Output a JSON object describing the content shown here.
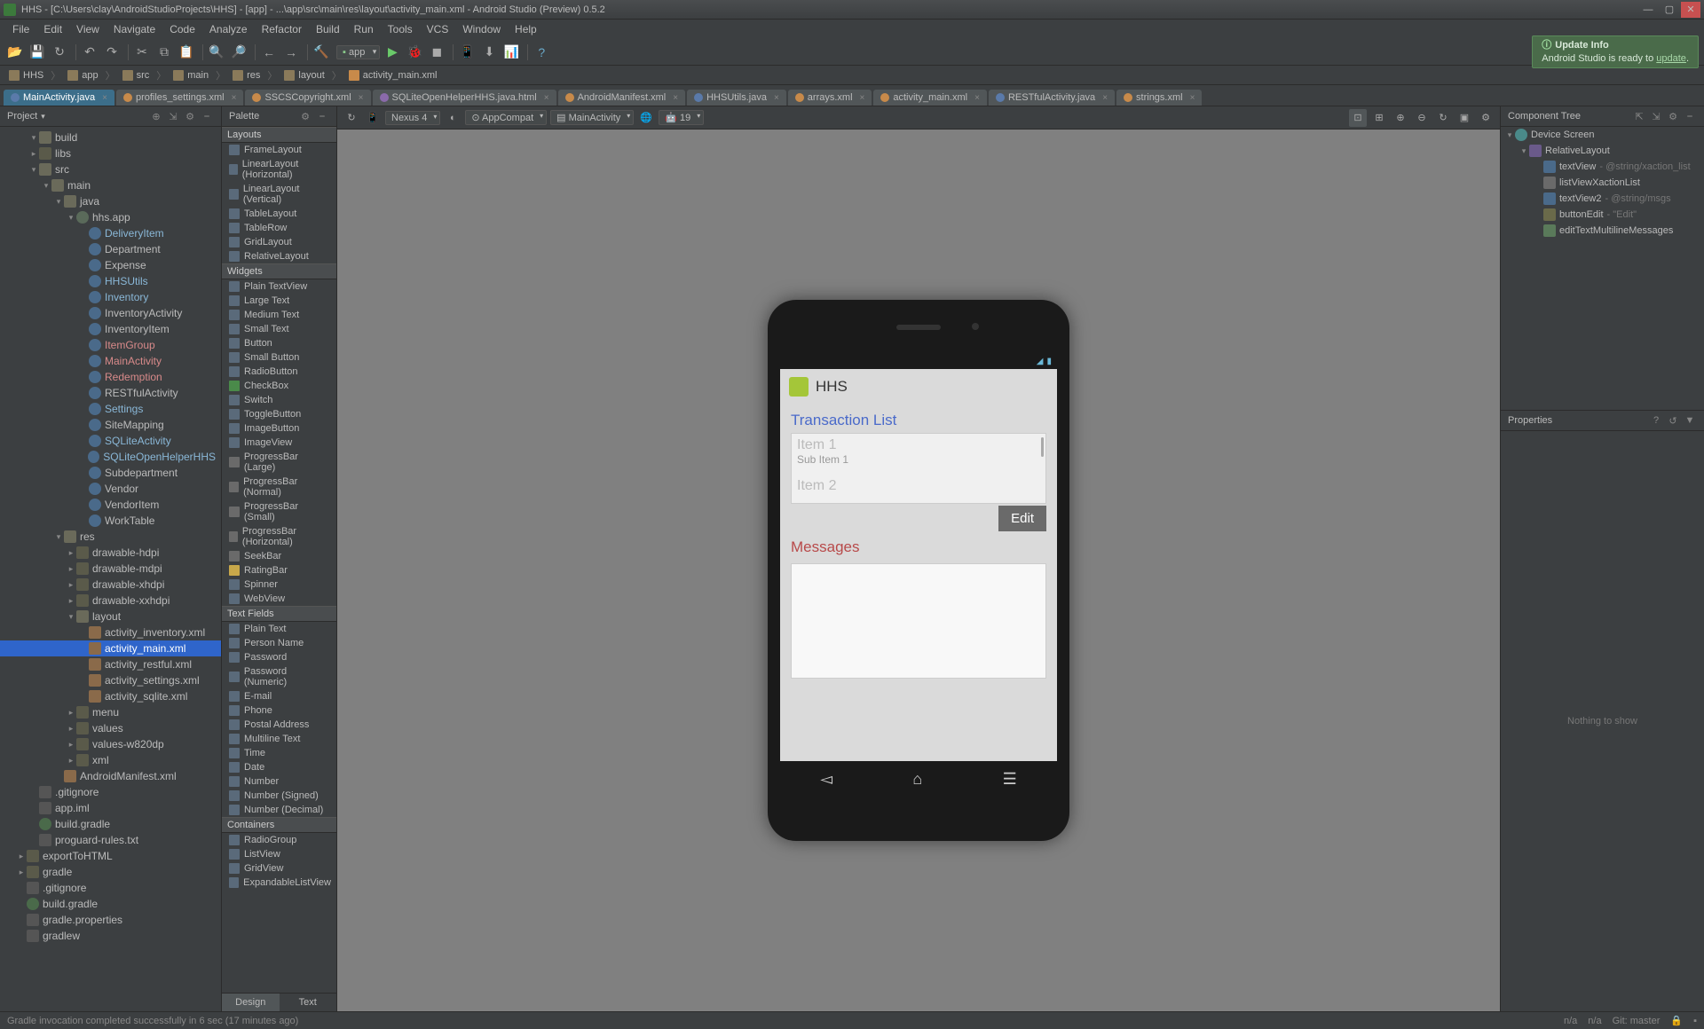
{
  "title": "HHS - [C:\\Users\\clay\\AndroidStudioProjects\\HHS] - [app] - ...\\app\\src\\main\\res\\layout\\activity_main.xml - Android Studio (Preview) 0.5.2",
  "menu": [
    "File",
    "Edit",
    "View",
    "Navigate",
    "Code",
    "Analyze",
    "Refactor",
    "Build",
    "Run",
    "Tools",
    "VCS",
    "Window",
    "Help"
  ],
  "toolbar": {
    "run_config": "app"
  },
  "notice": {
    "title": "Update Info",
    "msg_prefix": "Android Studio is ready to ",
    "link": "update",
    "msg_suffix": "."
  },
  "crumbs": [
    "HHS",
    "app",
    "src",
    "main",
    "res",
    "layout",
    "activity_main.xml"
  ],
  "tabs": [
    {
      "label": "MainActivity.java",
      "kind": "java",
      "active": true
    },
    {
      "label": "profiles_settings.xml",
      "kind": "xml"
    },
    {
      "label": "SSCSCopyright.xml",
      "kind": "xml"
    },
    {
      "label": "SQLiteOpenHelperHHS.java.html",
      "kind": "html"
    },
    {
      "label": "AndroidManifest.xml",
      "kind": "xml"
    },
    {
      "label": "HHSUtils.java",
      "kind": "java"
    },
    {
      "label": "arrays.xml",
      "kind": "xml"
    },
    {
      "label": "activity_main.xml",
      "kind": "xml"
    },
    {
      "label": "RESTfulActivity.java",
      "kind": "java"
    },
    {
      "label": "strings.xml",
      "kind": "xml"
    }
  ],
  "project": {
    "title": "Project"
  },
  "tree": [
    {
      "d": 2,
      "a": "▾",
      "i": "folder open",
      "t": "build"
    },
    {
      "d": 2,
      "a": "▸",
      "i": "folder",
      "t": "libs"
    },
    {
      "d": 2,
      "a": "▾",
      "i": "folder open",
      "t": "src"
    },
    {
      "d": 3,
      "a": "▾",
      "i": "folder open",
      "t": "main"
    },
    {
      "d": 4,
      "a": "▾",
      "i": "folder open",
      "t": "java"
    },
    {
      "d": 5,
      "a": "▾",
      "i": "pkg",
      "t": "hhs.app"
    },
    {
      "d": 6,
      "a": "",
      "i": "cls",
      "t": "DeliveryItem",
      "c": "blue"
    },
    {
      "d": 6,
      "a": "",
      "i": "cls",
      "t": "Department"
    },
    {
      "d": 6,
      "a": "",
      "i": "cls",
      "t": "Expense"
    },
    {
      "d": 6,
      "a": "",
      "i": "cls",
      "t": "HHSUtils",
      "c": "blue"
    },
    {
      "d": 6,
      "a": "",
      "i": "cls",
      "t": "Inventory",
      "c": "blue"
    },
    {
      "d": 6,
      "a": "",
      "i": "cls",
      "t": "InventoryActivity"
    },
    {
      "d": 6,
      "a": "",
      "i": "cls",
      "t": "InventoryItem"
    },
    {
      "d": 6,
      "a": "",
      "i": "cls",
      "t": "ItemGroup",
      "c": "red"
    },
    {
      "d": 6,
      "a": "",
      "i": "cls",
      "t": "MainActivity",
      "c": "red"
    },
    {
      "d": 6,
      "a": "",
      "i": "cls",
      "t": "Redemption",
      "c": "red"
    },
    {
      "d": 6,
      "a": "",
      "i": "cls",
      "t": "RESTfulActivity"
    },
    {
      "d": 6,
      "a": "",
      "i": "cls",
      "t": "Settings",
      "c": "blue"
    },
    {
      "d": 6,
      "a": "",
      "i": "cls",
      "t": "SiteMapping"
    },
    {
      "d": 6,
      "a": "",
      "i": "cls",
      "t": "SQLiteActivity",
      "c": "blue"
    },
    {
      "d": 6,
      "a": "",
      "i": "cls",
      "t": "SQLiteOpenHelperHHS",
      "c": "blue"
    },
    {
      "d": 6,
      "a": "",
      "i": "cls",
      "t": "Subdepartment"
    },
    {
      "d": 6,
      "a": "",
      "i": "cls",
      "t": "Vendor"
    },
    {
      "d": 6,
      "a": "",
      "i": "cls",
      "t": "VendorItem"
    },
    {
      "d": 6,
      "a": "",
      "i": "cls",
      "t": "WorkTable"
    },
    {
      "d": 4,
      "a": "▾",
      "i": "folder open",
      "t": "res"
    },
    {
      "d": 5,
      "a": "▸",
      "i": "folder",
      "t": "drawable-hdpi"
    },
    {
      "d": 5,
      "a": "▸",
      "i": "folder",
      "t": "drawable-mdpi"
    },
    {
      "d": 5,
      "a": "▸",
      "i": "folder",
      "t": "drawable-xhdpi"
    },
    {
      "d": 5,
      "a": "▸",
      "i": "folder",
      "t": "drawable-xxhdpi"
    },
    {
      "d": 5,
      "a": "▾",
      "i": "folder open",
      "t": "layout"
    },
    {
      "d": 6,
      "a": "",
      "i": "xml",
      "t": "activity_inventory.xml"
    },
    {
      "d": 6,
      "a": "",
      "i": "xml",
      "t": "activity_main.xml",
      "sel": true
    },
    {
      "d": 6,
      "a": "",
      "i": "xml",
      "t": "activity_restful.xml"
    },
    {
      "d": 6,
      "a": "",
      "i": "xml",
      "t": "activity_settings.xml"
    },
    {
      "d": 6,
      "a": "",
      "i": "xml",
      "t": "activity_sqlite.xml"
    },
    {
      "d": 5,
      "a": "▸",
      "i": "folder",
      "t": "menu"
    },
    {
      "d": 5,
      "a": "▸",
      "i": "folder",
      "t": "values"
    },
    {
      "d": 5,
      "a": "▸",
      "i": "folder",
      "t": "values-w820dp"
    },
    {
      "d": 5,
      "a": "▸",
      "i": "folder",
      "t": "xml"
    },
    {
      "d": 4,
      "a": "",
      "i": "xml",
      "t": "AndroidManifest.xml"
    },
    {
      "d": 2,
      "a": "",
      "i": "file",
      "t": ".gitignore"
    },
    {
      "d": 2,
      "a": "",
      "i": "file",
      "t": "app.iml"
    },
    {
      "d": 2,
      "a": "",
      "i": "gradle",
      "t": "build.gradle"
    },
    {
      "d": 2,
      "a": "",
      "i": "file",
      "t": "proguard-rules.txt"
    },
    {
      "d": 1,
      "a": "▸",
      "i": "folder",
      "t": "exportToHTML"
    },
    {
      "d": 1,
      "a": "▸",
      "i": "folder",
      "t": "gradle"
    },
    {
      "d": 1,
      "a": "",
      "i": "file",
      "t": ".gitignore"
    },
    {
      "d": 1,
      "a": "",
      "i": "gradle",
      "t": "build.gradle"
    },
    {
      "d": 1,
      "a": "",
      "i": "file",
      "t": "gradle.properties"
    },
    {
      "d": 1,
      "a": "",
      "i": "file",
      "t": "gradlew"
    }
  ],
  "palette": {
    "title": "Palette",
    "groups": [
      {
        "name": "Layouts",
        "items": [
          "FrameLayout",
          "LinearLayout (Horizontal)",
          "LinearLayout (Vertical)",
          "TableLayout",
          "TableRow",
          "GridLayout",
          "RelativeLayout"
        ]
      },
      {
        "name": "Widgets",
        "items": [
          "Plain TextView",
          "Large Text",
          "Medium Text",
          "Small Text",
          "Button",
          "Small Button",
          "RadioButton",
          "CheckBox",
          "Switch",
          "ToggleButton",
          "ImageButton",
          "ImageView",
          "ProgressBar (Large)",
          "ProgressBar (Normal)",
          "ProgressBar (Small)",
          "ProgressBar (Horizontal)",
          "SeekBar",
          "RatingBar",
          "Spinner",
          "WebView"
        ]
      },
      {
        "name": "Text Fields",
        "items": [
          "Plain Text",
          "Person Name",
          "Password",
          "Password (Numeric)",
          "E-mail",
          "Phone",
          "Postal Address",
          "Multiline Text",
          "Time",
          "Date",
          "Number",
          "Number (Signed)",
          "Number (Decimal)"
        ]
      },
      {
        "name": "Containers",
        "items": [
          "RadioGroup",
          "ListView",
          "GridView",
          "ExpandableListView"
        ]
      }
    ],
    "tabs": {
      "design": "Design",
      "text": "Text"
    }
  },
  "design_toolbar": {
    "device": "Nexus 4",
    "theme": "AppCompat",
    "activity": "MainActivity",
    "api": "19"
  },
  "preview": {
    "app_title": "HHS",
    "section1": "Transaction List",
    "list_item1": "Item 1",
    "list_sub1": "Sub Item 1",
    "list_item2": "Item 2",
    "edit_btn": "Edit",
    "section2": "Messages"
  },
  "component_tree": {
    "title": "Component Tree",
    "rows": [
      {
        "d": 0,
        "a": "▾",
        "i": "screen",
        "t": "Device Screen"
      },
      {
        "d": 1,
        "a": "▾",
        "i": "container",
        "t": "RelativeLayout"
      },
      {
        "d": 2,
        "a": "",
        "i": "text",
        "t": "textView",
        "ann": "- @string/xaction_list"
      },
      {
        "d": 2,
        "a": "",
        "i": "list",
        "t": "listViewXactionList"
      },
      {
        "d": 2,
        "a": "",
        "i": "text",
        "t": "textView2",
        "ann": "- @string/msgs"
      },
      {
        "d": 2,
        "a": "",
        "i": "button",
        "t": "buttonEdit",
        "ann": "- \"Edit\""
      },
      {
        "d": 2,
        "a": "",
        "i": "edit",
        "t": "editTextMultilineMessages"
      }
    ]
  },
  "properties": {
    "title": "Properties",
    "empty": "Nothing to show"
  },
  "status": {
    "msg": "Gradle invocation completed successfully in 6 sec (17 minutes ago)",
    "na1": "n/a",
    "na2": "n/a",
    "git": "Git: master"
  }
}
